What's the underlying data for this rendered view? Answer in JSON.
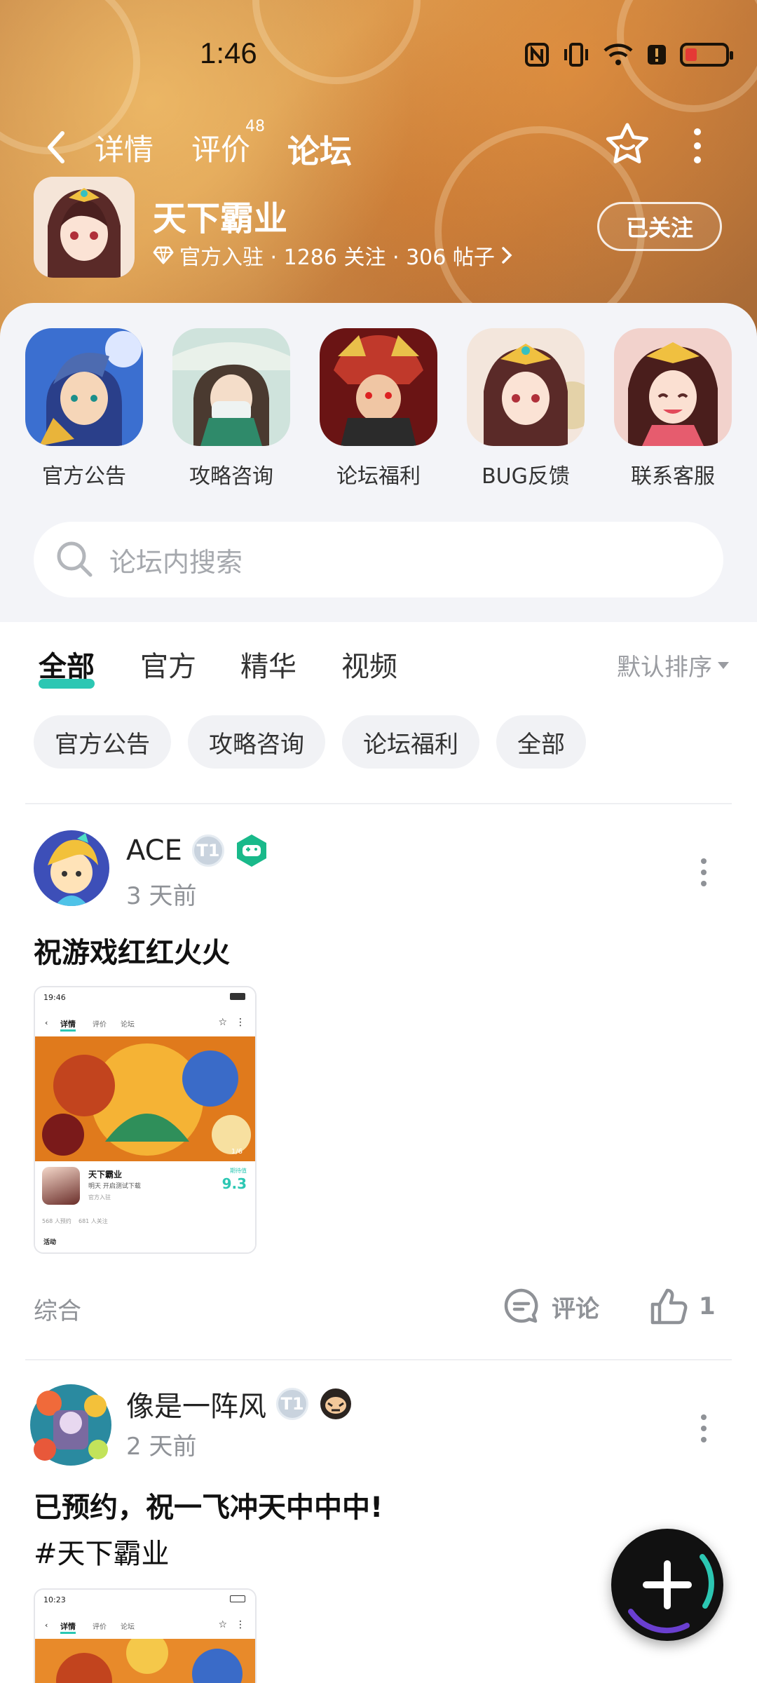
{
  "status_bar": {
    "time": "1:46"
  },
  "nav": {
    "tabs": [
      {
        "label": "详情"
      },
      {
        "label": "评价",
        "badge": "48"
      },
      {
        "label": "论坛"
      }
    ]
  },
  "game": {
    "name": "天下霸业",
    "meta": "官方入驻 · 1286 关注 · 306 帖子",
    "follow_label": "已关注"
  },
  "shortcuts": [
    {
      "label": "官方公告"
    },
    {
      "label": "攻略咨询"
    },
    {
      "label": "论坛福利"
    },
    {
      "label": "BUG反馈"
    },
    {
      "label": "联系客服"
    }
  ],
  "search": {
    "placeholder": "论坛内搜索"
  },
  "tabs": [
    {
      "label": "全部"
    },
    {
      "label": "官方"
    },
    {
      "label": "精华"
    },
    {
      "label": "视频"
    }
  ],
  "sort_label": "默认排序",
  "chips": [
    {
      "label": "官方公告"
    },
    {
      "label": "攻略咨询"
    },
    {
      "label": "论坛福利"
    },
    {
      "label": "全部"
    }
  ],
  "posts": [
    {
      "author": "ACE",
      "time": "3 天前",
      "title": "祝游戏红红火火",
      "category": "综合",
      "comment_label": "评论",
      "likes": "1",
      "thumb": {
        "time": "19:46",
        "tabs": [
          "详情",
          "评价",
          "论坛"
        ],
        "game_name": "天下霸业",
        "game_sub": "明天 开启测试下载",
        "game_badge": "官方入驻",
        "score_label": "期待值",
        "score": "9.3",
        "counter": "1/6",
        "stats": "568 人预约    681 人关注",
        "bottom": "活动"
      }
    },
    {
      "author": "像是一阵风",
      "time": "2 天前",
      "title": "已预约，祝一飞冲天中中中!",
      "tag": "#天下霸业",
      "thumb": {
        "time": "10:23",
        "tabs": [
          "详情",
          "评价",
          "论坛"
        ]
      }
    }
  ],
  "colors": {
    "accent": "#2cc7b3",
    "chip_bg": "#f1f2f5",
    "panel_bg": "#f3f4f8"
  }
}
